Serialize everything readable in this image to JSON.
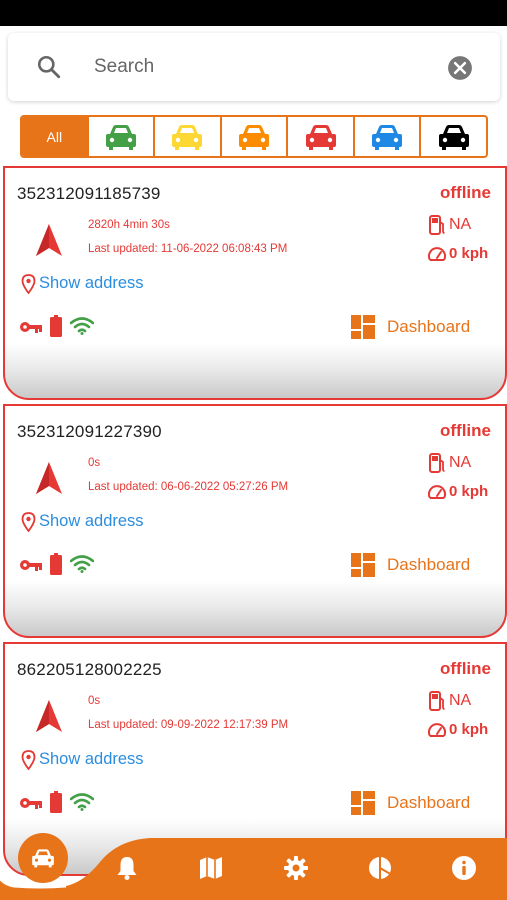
{
  "search": {
    "placeholder": "Search"
  },
  "filters": [
    {
      "label": "All",
      "icon": "car-icon",
      "color": "#ffffff"
    },
    {
      "label": "",
      "icon": "car-icon",
      "color": "#43a047"
    },
    {
      "label": "",
      "icon": "car-icon",
      "color": "#fdd835"
    },
    {
      "label": "",
      "icon": "car-icon",
      "color": "#fb8c00"
    },
    {
      "label": "",
      "icon": "car-icon",
      "color": "#e53935"
    },
    {
      "label": "",
      "icon": "car-icon",
      "color": "#1e88e5"
    },
    {
      "label": "",
      "icon": "car-icon",
      "color": "#000000"
    }
  ],
  "vehicles": [
    {
      "id": "352312091185739",
      "status": "offline",
      "duration": "2820h 4min 30s",
      "last_updated": "Last updated: 11-06-2022 06:08:43 PM",
      "fuel": "NA",
      "speed": "0 kph",
      "address_link": "Show address",
      "dashboard_label": "Dashboard"
    },
    {
      "id": "352312091227390",
      "status": "offline",
      "duration": "0s",
      "last_updated": "Last updated: 06-06-2022 05:27:26 PM",
      "fuel": "NA",
      "speed": "0 kph",
      "address_link": "Show address",
      "dashboard_label": "Dashboard"
    },
    {
      "id": "862205128002225",
      "status": "offline",
      "duration": "0s",
      "last_updated": "Last updated: 09-09-2022 12:17:39 PM",
      "fuel": "NA",
      "speed": "0 kph",
      "address_link": "Show address",
      "dashboard_label": "Dashboard"
    }
  ],
  "bottom_nav": {
    "items": [
      "car-icon",
      "bell-icon",
      "map-icon",
      "gear-icon",
      "pie-chart-icon",
      "info-icon"
    ]
  },
  "colors": {
    "accent": "#e8741a",
    "offline": "#e53935",
    "link": "#2b8ddf",
    "status_ok": "#43a047"
  }
}
